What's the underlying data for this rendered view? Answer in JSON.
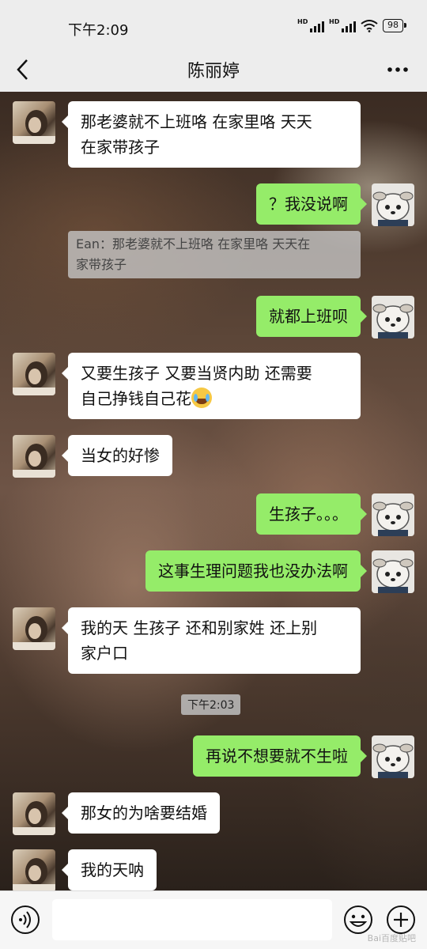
{
  "status_bar": {
    "time": "下午2:09",
    "signal1_label": "HD",
    "signal2_label": "HD",
    "battery": "98"
  },
  "header": {
    "title": "陈丽婷"
  },
  "messages": [
    {
      "text_line1": "那老婆就不上班咯 在家里咯 天天",
      "text_line2": "在家带孩子"
    },
    {
      "text": "？我没说啊"
    },
    {
      "quote_line1": "Ean：那老婆就不上班咯 在家里咯 天天在",
      "quote_line2": "家带孩子"
    },
    {
      "text": "就都上班呗"
    },
    {
      "text_line1": "又要生孩子 又要当贤内助 还需要",
      "text_line2": "自己挣钱自己花",
      "emoji": "joy-tears"
    },
    {
      "text": "当女的好惨"
    },
    {
      "text": "生孩子。。。"
    },
    {
      "text": "这事生理问题我也没办法啊"
    },
    {
      "text_line1": "我的天 生孩子 还和别家姓 还上别",
      "text_line2": "家户口"
    },
    {
      "text": "再说不想要就不生啦"
    },
    {
      "text": "那女的为啥要结婚"
    },
    {
      "text": "我的天呐"
    }
  ],
  "timestamp": "下午2:03",
  "input": {
    "value": "",
    "placeholder": ""
  },
  "watermark": "Bai百度贴吧"
}
